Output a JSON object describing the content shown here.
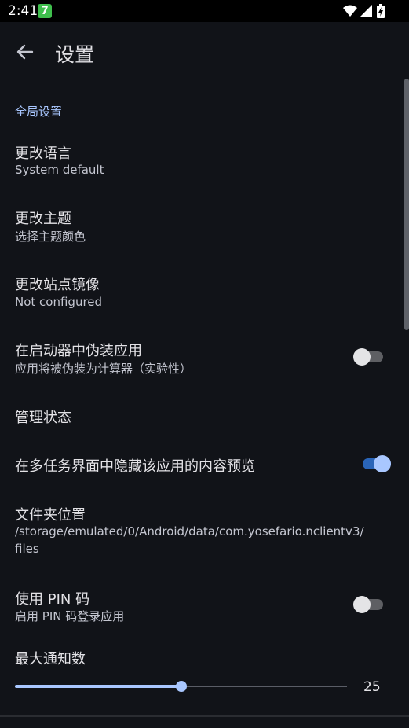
{
  "status_bar": {
    "time": "2:41",
    "notification_badge": "7",
    "icons": [
      "wifi-icon",
      "signal-icon",
      "battery-charging-icon"
    ]
  },
  "app_bar": {
    "title": "设置",
    "back_icon": "arrow-left-icon"
  },
  "colors": {
    "background": "#111318",
    "accent": "#a9c7ff",
    "switch_on_track": "#2a65b8",
    "switch_off_track": "#5e5f63"
  },
  "section": {
    "header": "全局设置"
  },
  "prefs": {
    "language": {
      "title": "更改语言",
      "summary": "System default"
    },
    "theme": {
      "title": "更改主题",
      "summary": "选择主题颜色"
    },
    "mirror": {
      "title": "更改站点镜像",
      "summary": "Not configured"
    },
    "disguise": {
      "title": "在启动器中伪装应用",
      "summary": "应用将被伪装为计算器（实验性）",
      "enabled": false
    },
    "manage_status": {
      "title": "管理状态"
    },
    "hide_preview": {
      "title": "在多任务界面中隐藏该应用的内容预览",
      "enabled": true
    },
    "folder": {
      "title": "文件夹位置",
      "summary_line1": "/storage/emulated/0/Android/data/com.yosefario.nclientv3/",
      "summary_line2": "files"
    },
    "pin": {
      "title": "使用 PIN 码",
      "summary": "启用 PIN 码登录应用",
      "enabled": false
    },
    "max_notifications": {
      "title": "最大通知数",
      "value": "25",
      "fraction": 0.5
    }
  }
}
